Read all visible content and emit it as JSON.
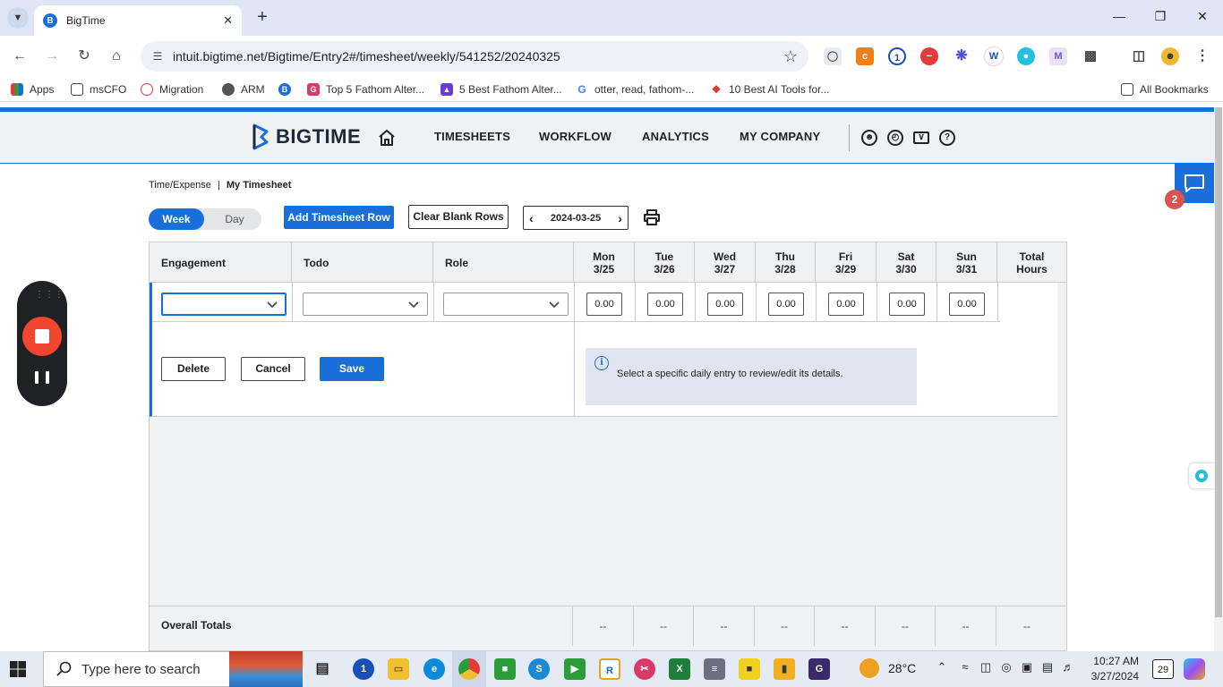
{
  "browser": {
    "tab_title": "BigTime",
    "url": "intuit.bigtime.net/Bigtime/Entry2#/timesheet/weekly/541252/20240325",
    "bookmarks": [
      {
        "label": "Apps"
      },
      {
        "label": "msCFO"
      },
      {
        "label": "Migration"
      },
      {
        "label": "ARM"
      },
      {
        "label": ""
      },
      {
        "label": "Top 5 Fathom Alter..."
      },
      {
        "label": "5 Best Fathom Alter..."
      },
      {
        "label": "otter, read, fathom-..."
      },
      {
        "label": "10 Best AI Tools for..."
      }
    ],
    "all_bookmarks": "All Bookmarks"
  },
  "app": {
    "logo": "BIGTIME",
    "nav": [
      "TIMESHEETS",
      "WORKFLOW",
      "ANALYTICS",
      "MY COMPANY"
    ],
    "notification_count": "2"
  },
  "breadcrumb": {
    "parent": "Time/Expense",
    "separator": "|",
    "current": "My Timesheet"
  },
  "controls": {
    "week_label": "Week",
    "day_label": "Day",
    "add_row": "Add Timesheet Row",
    "clear_rows": "Clear Blank Rows",
    "week_start": "2024-03-25"
  },
  "grid": {
    "columns": {
      "engagement": "Engagement",
      "todo": "Todo",
      "role": "Role",
      "total_line1": "Total",
      "total_line2": "Hours"
    },
    "days": [
      {
        "name": "Mon",
        "date": "3/25",
        "hours": "0.00",
        "total": "--"
      },
      {
        "name": "Tue",
        "date": "3/26",
        "hours": "0.00",
        "total": "--"
      },
      {
        "name": "Wed",
        "date": "3/27",
        "hours": "0.00",
        "total": "--"
      },
      {
        "name": "Thu",
        "date": "3/28",
        "hours": "0.00",
        "total": "--"
      },
      {
        "name": "Fri",
        "date": "3/29",
        "hours": "0.00",
        "total": "--"
      },
      {
        "name": "Sat",
        "date": "3/30",
        "hours": "0.00",
        "total": "--"
      },
      {
        "name": "Sun",
        "date": "3/31",
        "hours": "0.00",
        "total": "--"
      }
    ],
    "delete": "Delete",
    "cancel": "Cancel",
    "save": "Save",
    "info_message": "Select a specific daily entry to review/edit its details.",
    "overall_totals": "Overall Totals",
    "grand_total": "--"
  },
  "taskbar": {
    "search_placeholder": "Type here to search",
    "weather": "28°C",
    "time": "10:27 AM",
    "date": "3/27/2024",
    "notifications": "29"
  }
}
